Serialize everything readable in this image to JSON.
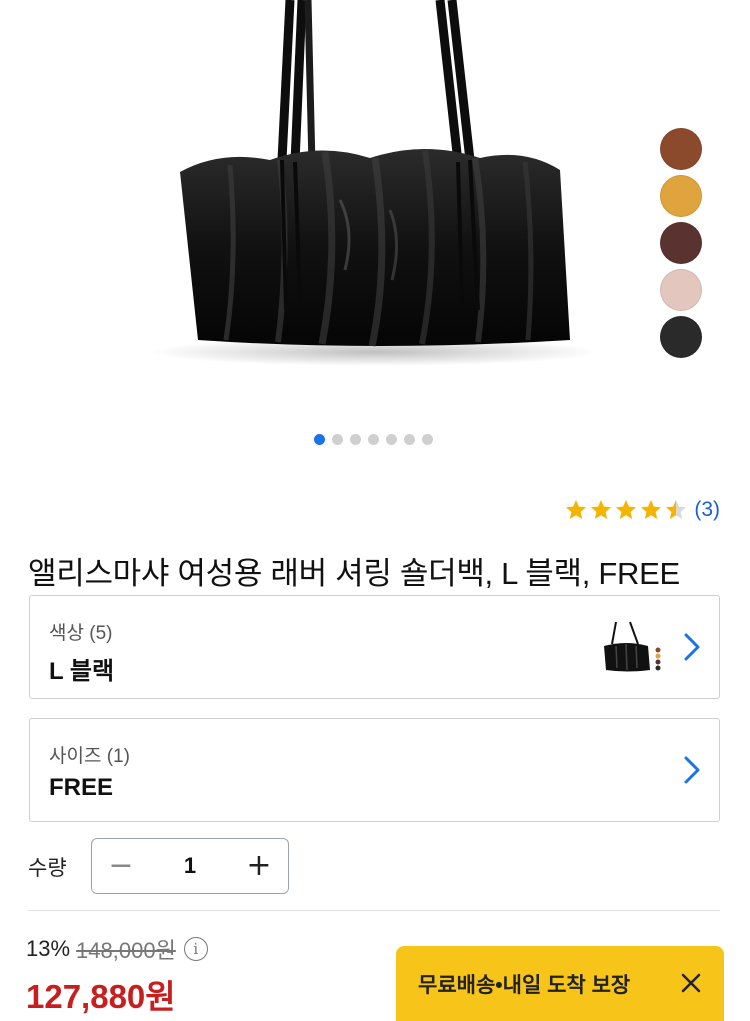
{
  "product": {
    "title": "앨리스마샤 여성용 래버 셔링 숄더백, L 블랙, FREE",
    "rating": 4.5,
    "review_count": "(3)"
  },
  "gallery": {
    "total_images": 7,
    "active_index": 0,
    "swatches": [
      {
        "name": "brown",
        "color": "#8b4a2b"
      },
      {
        "name": "mustard",
        "color": "#e0a43e"
      },
      {
        "name": "burgundy",
        "color": "#5a3230"
      },
      {
        "name": "pink-beige",
        "color": "#e3c7bf"
      },
      {
        "name": "black",
        "color": "#2a2a2a"
      }
    ]
  },
  "options": {
    "color": {
      "label": "색상 (5)",
      "value": "L 블랙"
    },
    "size": {
      "label": "사이즈 (1)",
      "value": "FREE"
    }
  },
  "quantity": {
    "label": "수량",
    "value": "1",
    "minus": "−",
    "plus": "+"
  },
  "price": {
    "discount_rate": "13%",
    "original": "148,000원",
    "sale": "127,880원",
    "info": "i"
  },
  "shipping": {
    "banner_text": "무료배송•내일 도착 보장"
  },
  "colors": {
    "accent_blue": "#1a73e8",
    "price_red": "#c71f1f",
    "banner_yellow": "#f7c519",
    "star": "#f4b400"
  }
}
